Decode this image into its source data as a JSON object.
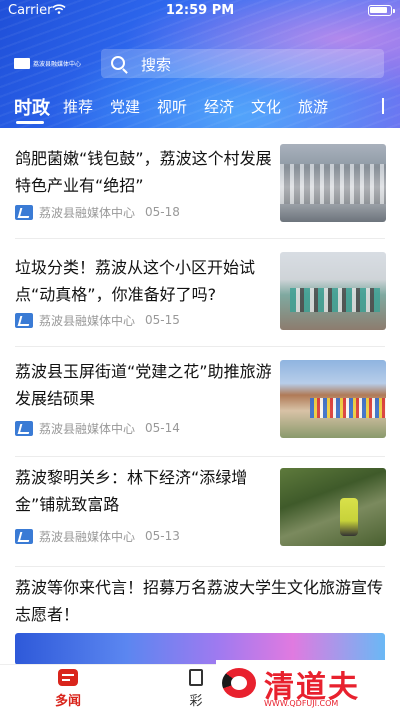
{
  "status_bar": {
    "carrier": "Carrier",
    "time": "12:59 PM"
  },
  "header": {
    "logo_text": "荔波县融媒体中心",
    "search_placeholder": "搜索"
  },
  "tabs": [
    {
      "label": "时政",
      "active": true
    },
    {
      "label": "推荐"
    },
    {
      "label": "党建"
    },
    {
      "label": "视听"
    },
    {
      "label": "经济"
    },
    {
      "label": "文化"
    },
    {
      "label": "旅游"
    }
  ],
  "articles": [
    {
      "title": "鸽肥菌嫩“钱包鼓”，荔波这个村发展特色产业有“绝招”",
      "source": "荔波县融媒体中心",
      "date": "05-18"
    },
    {
      "title": "垃圾分类！荔波从这个小区开始试点“动真格”，你准备好了吗?",
      "source": "荔波县融媒体中心",
      "date": "05-15"
    },
    {
      "title": "荔波县玉屏街道“党建之花”助推旅游发展结硕果",
      "source": "荔波县融媒体中心",
      "date": "05-14"
    },
    {
      "title": "荔波黎明关乡：林下经济“添绿增金”铺就致富路",
      "source": "荔波县融媒体中心",
      "date": "05-13"
    },
    {
      "title": "荔波等你来代言！招募万名荔波大学生文化旅游宣传志愿者！"
    }
  ],
  "tabbar": {
    "news_label": "多闻",
    "second_label": "彩"
  },
  "watermark": {
    "brand": "清道夫",
    "url": "WWW.QDFUJI.COM"
  },
  "colors": {
    "accent_red": "#d9251c",
    "header_blue": "#2f6af0"
  }
}
